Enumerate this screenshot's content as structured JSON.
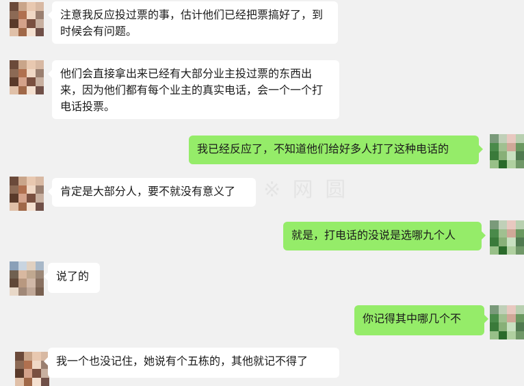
{
  "messages": [
    {
      "side": "in",
      "text": "注意我反应投过票的事，估计他们已经把票搞好了，到时候会有问题。"
    },
    {
      "side": "in",
      "text": "他们会直接拿出来已经有大部分业主投过票的东西出来，因为他们都有每个业主的真实电话，会一个一个打电话投票。"
    },
    {
      "side": "out",
      "text": "我已经反应了，不知道他们给好多人打了这种电话的"
    },
    {
      "side": "in",
      "text": "肯定是大部分人，要不就没有意义了"
    },
    {
      "side": "out",
      "text": "就是，打电话的没说是选哪九个人"
    },
    {
      "side": "in",
      "text": "说了的"
    },
    {
      "side": "out",
      "text": "你记得其中哪几个不"
    },
    {
      "side": "in",
      "text": "我一个也没记住，她说有个五栋的，其他就记不得了"
    }
  ],
  "colors": {
    "background": "#f1f1f1",
    "incoming_bubble": "#ffffff",
    "outgoing_bubble": "#95ec69",
    "avatar_palettes": {
      "contact_a": [
        "#6b4a3a",
        "#c9a58a",
        "#e8c8b0",
        "#d8b9a3",
        "#8c6a55",
        "#b0704f",
        "#f0d8c5",
        "#9a7f70",
        "#5a3a2a",
        "#d4a28a",
        "#7a5040",
        "#c8b0a0",
        "#e0c0a8",
        "#a06848",
        "#f4e0d0",
        "#705048"
      ],
      "contact_b": [
        "#8aa0b8",
        "#c8d4e0",
        "#e0d0c0",
        "#a8b8c8",
        "#706050",
        "#d8b8a0",
        "#c0a890",
        "#9c8878",
        "#604838",
        "#b89880",
        "#d0b8a8",
        "#887060",
        "#e8d8c8",
        "#a08878",
        "#c0a898",
        "#786050"
      ],
      "self": [
        "#7a9a7a",
        "#c0d0b8",
        "#e8c8c0",
        "#b8d0b0",
        "#4a8a4a",
        "#a0c090",
        "#d0a898",
        "#6a9860",
        "#3a7a3a",
        "#88b078",
        "#c8e0c0",
        "#507a50",
        "#98c088",
        "#2a6a2a",
        "#b0d0a0",
        "#709868"
      ]
    }
  }
}
